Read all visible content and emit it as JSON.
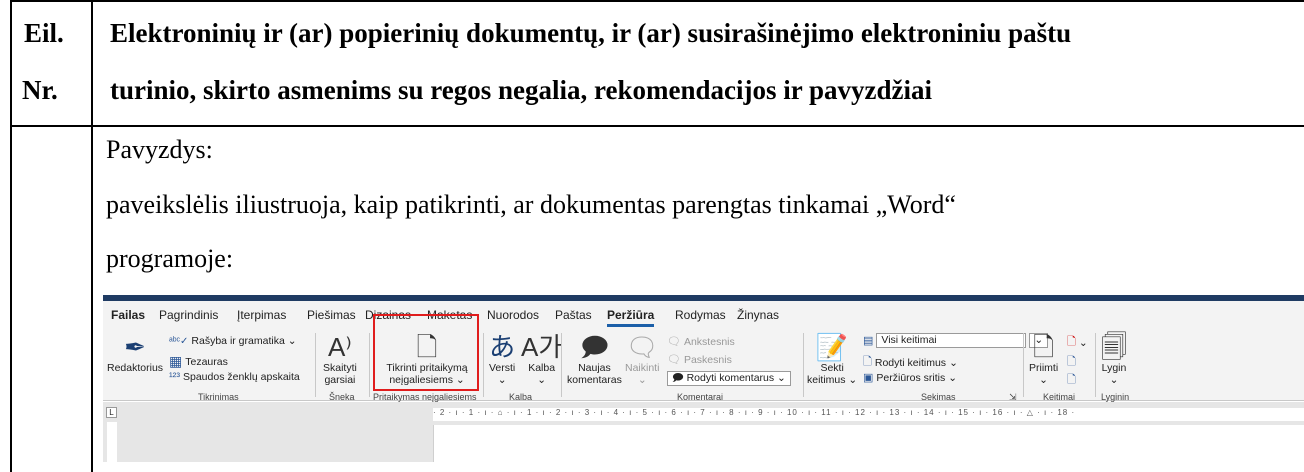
{
  "table": {
    "header_col1_line1": "Eil.",
    "header_col1_line2": "Nr.",
    "header_col2_line1": "Elektroninių ir (ar) popierinių dokumentų, ir (ar) susirašinėjimo elektroniniu paštu",
    "header_col2_line2": "turinio, skirto asmenims su regos negalia, rekomendacijos ir pavyzdžiai",
    "body_line1": "Pavyzdys:",
    "body_line2": "paveikslėlis iliustruoja, kaip patikrinti, ar dokumentas parengtas tinkamai „Word“",
    "body_line3": "programoje:"
  },
  "ribbon": {
    "tabs": [
      "Failas",
      "Pagrindinis",
      "Įterpimas",
      "Piešimas",
      "Dizainas",
      "Maketas",
      "Nuorodos",
      "Paštas",
      "Peržiūra",
      "Rodymas",
      "Žinynas"
    ],
    "active_tab": "Peržiūra",
    "redaktorius": "Redaktorius",
    "rasyba": "Rašyba ir gramatika",
    "tezauras": "Tezauras",
    "spaudos": "Spaudos ženklų apskaita",
    "skaityti_1": "Skaityti",
    "skaityti_2": "garsiai",
    "tikrinti_1": "Tikrinti pritaikymą",
    "tikrinti_2": "neįgaliesiems",
    "versti": "Versti",
    "kalba": "Kalba",
    "naujas_1": "Naujas",
    "naujas_2": "komentaras",
    "naikinti": "Naikinti",
    "ankstesnis": "Ankstesnis",
    "paskesnis": "Paskesnis",
    "rodyti_komentarus": "Rodyti komentarus",
    "sekti_1": "Sekti",
    "sekti_2": "keitimus",
    "visi_keitimai": "Visi keitimai",
    "rodyti_keitimus": "Rodyti keitimus",
    "perziuros_sritis": "Peržiūros sritis",
    "priimti": "Priimti",
    "lygin": "Lygin",
    "group_tikrinimas": "Tikrinimas",
    "group_sneka": "Šneka",
    "group_pritaikymas": "Pritaikymas neįgaliesiems",
    "group_kalba": "Kalba",
    "group_komentarai": "Komentarai",
    "group_sekimas": "Sekimas",
    "group_keitimai": "Keitimai",
    "group_lygin": "Lyginin",
    "ruler_text": "· 2 · ı · 1 · ı · ⌂ · ı · 1 · ı · 2 · ı · 3 · ı · 4 · ı · 5 · ı · 6 · ı · 7 · ı · 8 · ı · 9 · ı · 10 · ı · 11 · ı · 12 · ı · 13 · ı · 14 · ı · 15 · ı · 16 · ı · △ · ı · 18 ·"
  },
  "colors": {
    "accent": "#1b5fa8",
    "highlight_box": "#e01c1c",
    "title_bar": "#1f3b63"
  }
}
